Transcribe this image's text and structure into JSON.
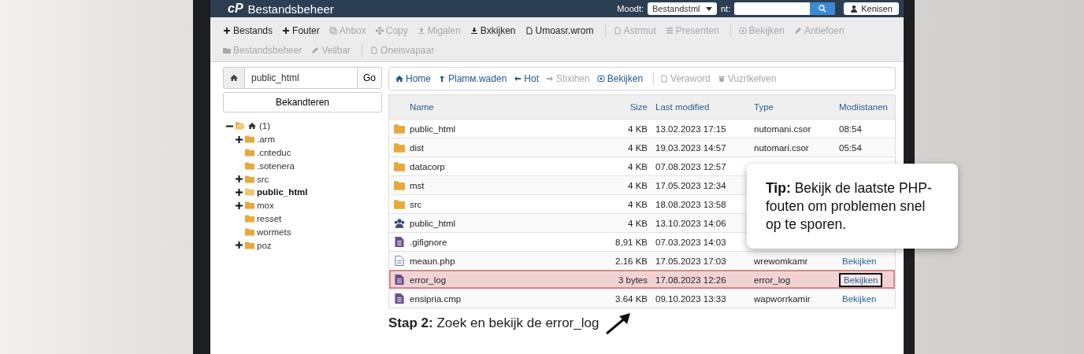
{
  "header": {
    "logo": "cP",
    "title": "Bestandsbeheer",
    "mode_label": "Moodt:",
    "mode_value": "Bestandstml",
    "filter_label": "nt:",
    "button": "Kenisen"
  },
  "toolbar": [
    [
      {
        "label": "Bestands",
        "disabled": false
      },
      {
        "label": "Fouter",
        "disabled": false
      },
      {
        "label": "Ahbox",
        "disabled": true
      },
      {
        "label": "Copy",
        "disabled": true
      },
      {
        "label": "Migalen",
        "disabled": true
      },
      {
        "label": "Bxkijken",
        "disabled": false
      },
      {
        "label": "Umoasr.wrom",
        "disabled": false
      },
      {
        "label": "Astrmut",
        "disabled": true
      },
      {
        "label": "Presenten",
        "disabled": true
      },
      {
        "label": "Bekijken",
        "disabled": true
      },
      {
        "label": "Antiefoen",
        "disabled": true
      }
    ],
    [
      {
        "label": "Bestandsbeheer",
        "disabled": true
      },
      {
        "label": "Veilbar",
        "disabled": true
      },
      {
        "label": "Oneisvapaar",
        "disabled": true
      }
    ]
  ],
  "path": {
    "value": "public_html",
    "go": "Go"
  },
  "reload_button": "Bekandteren",
  "tree": [
    {
      "label": "(1)",
      "expanded": true,
      "selected": false,
      "children": [
        {
          "label": ".arm",
          "expandable": true,
          "selected": false
        },
        {
          "label": ".cnteduc",
          "expandable": false,
          "selected": false
        },
        {
          "label": ".sotenera",
          "expandable": false,
          "selected": false
        },
        {
          "label": "src",
          "expandable": true,
          "selected": false
        },
        {
          "label": "public_html",
          "expandable": true,
          "selected": true
        },
        {
          "label": "mox",
          "expandable": true,
          "selected": false
        },
        {
          "label": "resset",
          "expandable": false,
          "selected": false
        },
        {
          "label": "wormets",
          "expandable": false,
          "selected": false
        },
        {
          "label": "poz",
          "expandable": true,
          "selected": false
        }
      ]
    }
  ],
  "nav": [
    {
      "label": "Home",
      "disabled": false
    },
    {
      "label": "Plamм.waden",
      "disabled": false
    },
    {
      "label": "Hot",
      "disabled": false
    },
    {
      "label": "Stixihen",
      "disabled": true
    },
    {
      "label": "Bekijken",
      "disabled": false
    },
    {
      "label": "Veraword",
      "disabled": true
    },
    {
      "label": "Vuzrlkelven",
      "disabled": true
    }
  ],
  "table": {
    "columns": [
      "Name",
      "Size",
      "Last modified",
      "Type",
      "Modiistanen"
    ],
    "rows": [
      {
        "kind": "folder",
        "name": "public_html",
        "size": "4 KB",
        "modified": "13.02.2023 17:15",
        "type": "nutomani.csor",
        "column_5": "08:54",
        "selected": false
      },
      {
        "kind": "folder",
        "name": "dist",
        "size": "4 KB",
        "modified": "19.03.2023 14:57",
        "type": "nutomari.csor",
        "column_5": "05:54",
        "selected": false
      },
      {
        "kind": "folder",
        "name": "datacorp",
        "size": "4 KB",
        "modified": "07.08.2023 12:57",
        "selected": false
      },
      {
        "kind": "folder",
        "name": "mst",
        "size": "4 KB",
        "modified": "17.05.2023 12:34",
        "selected": false
      },
      {
        "kind": "folder",
        "name": "src",
        "size": "4 KB",
        "modified": "18.08.2023 13:58",
        "selected": false
      },
      {
        "kind": "group",
        "name": "public_html",
        "size": "4 KB",
        "modified": "13.10.2023 14:06",
        "selected": false
      },
      {
        "kind": "file",
        "name": ".gifignore",
        "size": "8,91 KB",
        "modified": "07.03.2023 14:03",
        "selected": false
      },
      {
        "kind": "php",
        "name": "meaun.php",
        "size": "2.16 KB",
        "modified": "17.05.2023 17:03",
        "type": "wrewomkamr",
        "action": "Bekijken",
        "selected": false
      },
      {
        "kind": "file",
        "name": "error_log",
        "size": "3 bytes",
        "modified": "17.08.2023 12:26",
        "type": "error_log",
        "action": "Bekijken",
        "selected": true
      },
      {
        "kind": "file",
        "name": "ensipria.cmp",
        "size": "3.64 KB",
        "modified": "09.10.2023 13:33",
        "type": "wapworrkamir",
        "action": "Bekijken",
        "selected": false
      }
    ]
  },
  "tip": "**Tip:** Bekijk de laatste PHP-fouten om problemen snel op te sporen.",
  "step": "**Stap 2:** Zoek en bekijk de error_log"
}
